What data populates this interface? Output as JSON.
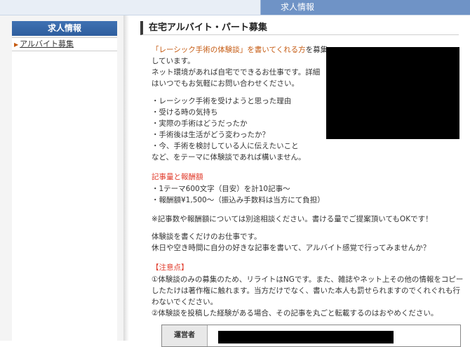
{
  "header": {
    "tab_label": "求人情報"
  },
  "sidebar": {
    "title": "求人情報",
    "items": [
      {
        "label": "アルバイト募集"
      }
    ]
  },
  "main": {
    "title": "在宅アルバイト・パート募集",
    "intro_highlight": "「レーシック手術の体験談」を書いてくれる方",
    "intro_tail": "を募集",
    "intro_lines": [
      "しています。",
      "ネット環境があれば自宅でできるお仕事です。詳細",
      "はいつでもお気軽にお問い合わせください。"
    ],
    "topic_lines": [
      "・レーシック手術を受けようと思った理由",
      "・受ける時の気持ち",
      "・実際の手術はどうだったか",
      "・手術後は生活がどう変わったか？",
      "・今、手術を検討している人に伝えたいこと",
      "など、をテーマに体験談であれば構いません。"
    ],
    "pay_heading": "記事量と報酬額",
    "pay_lines": [
      "・1テーマ600文字（目安）を計10記事〜",
      "・報酬額¥1,500〜（振込み手数料は当方にて負担）"
    ],
    "note_line": "※記事数や報酬額については別途相談ください。書ける量でご提案頂いてもOKです！",
    "body_lines": [
      "体験談を書くだけのお仕事です。",
      "休日や空き時間に自分の好きな記事を書いて、アルバイト感覚で行ってみませんか？"
    ],
    "caution_heading": "【注意点】",
    "caution_lines": [
      "①体験談のみの募集のため、リライトはNGです。また、雑誌やネット上その他の情報をコピー",
      "したたけは著作権に触れます。当方だけでなく、書いた本人も罰せられますのでくれぐれも行",
      "わないでください。",
      "②体験談を投稿した経験がある場合、その記事を丸ごと転載するのはおやめください。"
    ],
    "table_header": "運営者"
  }
}
